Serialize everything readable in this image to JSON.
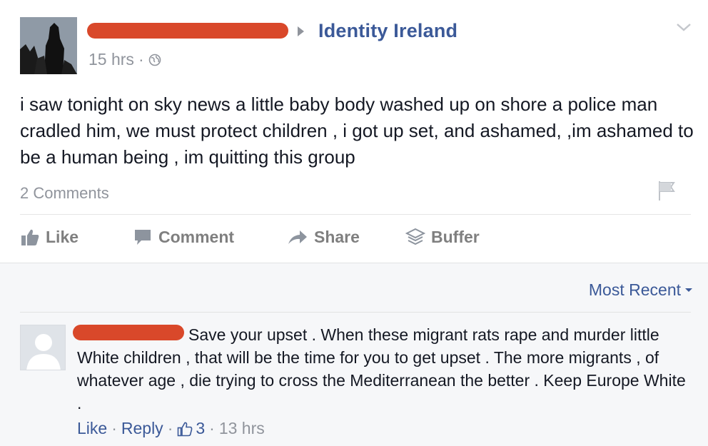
{
  "post": {
    "author_redacted": true,
    "group_name": "Identity Ireland",
    "time": "15 hrs",
    "separator": "·",
    "privacy_icon": "globe-icon",
    "text": "i saw tonight on sky news a little baby body washed up on shore a police man cradled him, we must protect children , i got up set, and ashamed, ,im ashamed to be a human being , im quitting this group",
    "comments_count": "2 Comments"
  },
  "actions": {
    "like": "Like",
    "comment": "Comment",
    "share": "Share",
    "buffer": "Buffer"
  },
  "comments": {
    "sort_label": "Most Recent",
    "items": [
      {
        "author_redacted": true,
        "text": "Save your upset . When these migrant rats rape and murder little White children , that will be the time for you to get upset . The more migrants , of whatever age , die trying to cross the Mediterranean the better . Keep Europe White .",
        "like_label": "Like",
        "reply_label": "Reply",
        "like_count": "3",
        "time": "13 hrs",
        "separator": "·"
      }
    ]
  },
  "colors": {
    "link": "#3b5998",
    "muted": "#90949c",
    "redaction": "#d9482a",
    "action_gray": "#7f7f7f"
  }
}
